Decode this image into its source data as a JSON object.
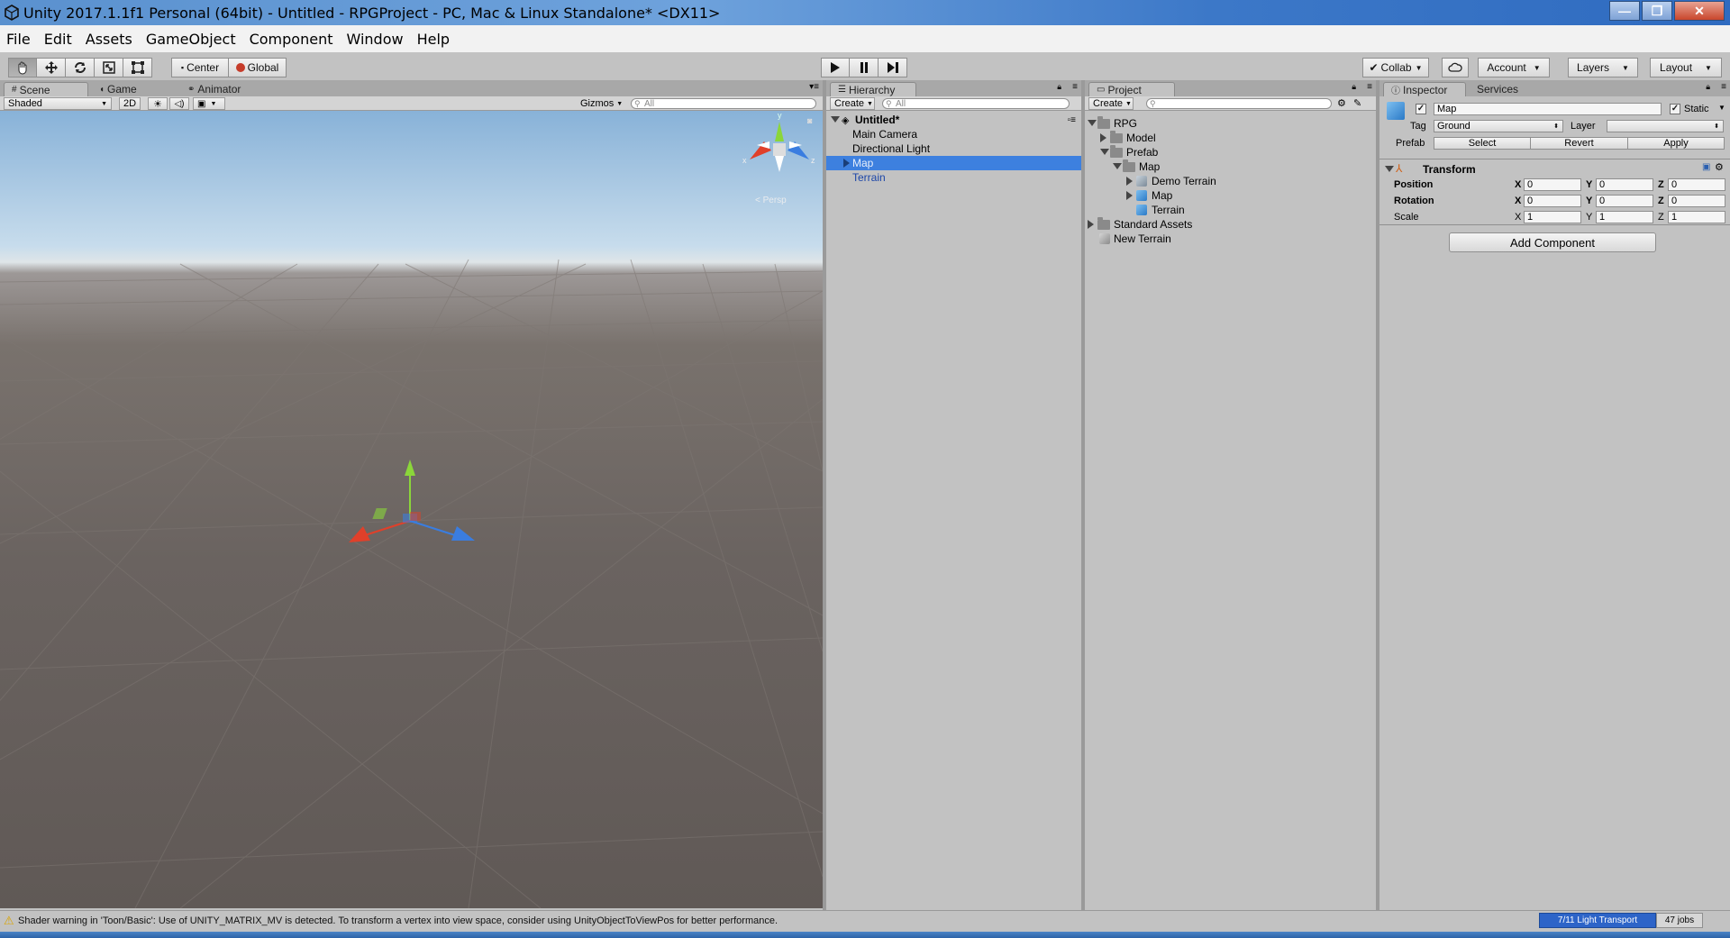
{
  "window": {
    "title": "Unity 2017.1.1f1 Personal (64bit) - Untitled - RPGProject - PC, Mac & Linux Standalone* <DX11>",
    "minimize_glyph": "—",
    "maximize_glyph": "❐",
    "close_glyph": "✕"
  },
  "menu": [
    "File",
    "Edit",
    "Assets",
    "GameObject",
    "Component",
    "Window",
    "Help"
  ],
  "toolbar": {
    "pivot_label": "Center",
    "space_label": "Global",
    "collab_label": "Collab",
    "account_label": "Account",
    "layers_label": "Layers",
    "layout_label": "Layout",
    "play_icon": "play-icon",
    "pause_icon": "pause-icon",
    "step_icon": "step-icon"
  },
  "scene": {
    "tabs": [
      "Scene",
      "Game",
      "Animator"
    ],
    "shading_mode": "Shaded",
    "mode_2d": "2D",
    "gizmos_label": "Gizmos",
    "search_placeholder": "All",
    "persp_label": "Persp",
    "axis_x": "x",
    "axis_y": "y",
    "axis_z": "z"
  },
  "hierarchy": {
    "tab": "Hierarchy",
    "create_label": "Create",
    "search_placeholder": "All",
    "scene_name": "Untitled*",
    "items": [
      "Main Camera",
      "Directional Light",
      "Map",
      "Terrain"
    ],
    "selected": "Map"
  },
  "project": {
    "tab": "Project",
    "create_label": "Create",
    "tree": {
      "rpg": "RPG",
      "model": "Model",
      "prefab": "Prefab",
      "map_folder": "Map",
      "demo_terrain": "Demo Terrain",
      "map_prefab": "Map",
      "terrain": "Terrain",
      "standard_assets": "Standard Assets",
      "new_terrain": "New Terrain"
    }
  },
  "inspector": {
    "tabs": [
      "Inspector",
      "Services"
    ],
    "object_name": "Map",
    "static_label": "Static",
    "tag_label": "Tag",
    "tag_value": "Ground",
    "layer_label": "Layer",
    "layer_value": "",
    "prefab_label": "Prefab",
    "prefab_select": "Select",
    "prefab_revert": "Revert",
    "prefab_apply": "Apply",
    "transform_title": "Transform",
    "position_label": "Position",
    "rotation_label": "Rotation",
    "scale_label": "Scale",
    "axis_x": "X",
    "axis_y": "Y",
    "axis_z": "Z",
    "position": {
      "x": "0",
      "y": "0",
      "z": "0"
    },
    "rotation": {
      "x": "0",
      "y": "0",
      "z": "0"
    },
    "scale": {
      "x": "1",
      "y": "1",
      "z": "1"
    },
    "add_component": "Add Component"
  },
  "status": {
    "warning": "Shader warning in 'Toon/Basic': Use of UNITY_MATRIX_MV is detected. To transform a vertex into view space, consider using UnityObjectToViewPos for better performance.",
    "progress_label": "7/11 Light Transport",
    "jobs_label": "47 jobs"
  },
  "colors": {
    "selection": "#3d80df",
    "panel_bg": "#c2c2c2",
    "gizmo_x": "#e0402a",
    "gizmo_y": "#8bd63a",
    "gizmo_z": "#3a7de0"
  }
}
